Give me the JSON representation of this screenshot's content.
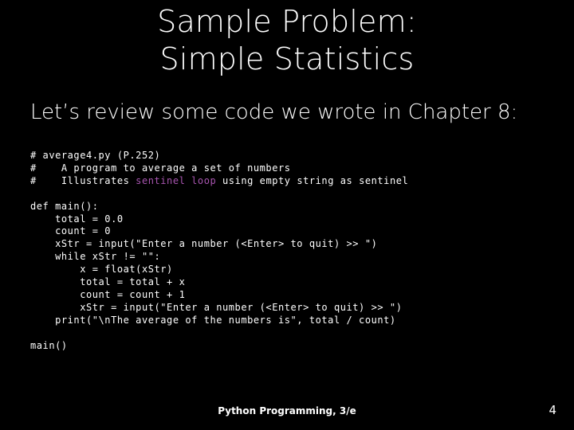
{
  "slide": {
    "background_color": "#000000",
    "text_color": "#ffffff",
    "accent_color": "#a855b0"
  },
  "title": {
    "line1": "Sample Problem:",
    "line2": "Simple Statistics"
  },
  "body": {
    "lead_in": "Let’s review some code we wrote in Chapter 8:"
  },
  "code": {
    "language": "python",
    "lines": [
      {
        "text": "# average4.py (P.252)"
      },
      {
        "text": "#    A program to average a set of numbers"
      },
      {
        "pre": "#    Illustrates ",
        "highlight": "sentinel loop",
        "post": " using empty string as sentinel"
      },
      {
        "text": ""
      },
      {
        "text": "def main():"
      },
      {
        "text": "    total = 0.0"
      },
      {
        "text": "    count = 0"
      },
      {
        "text": "    xStr = input(\"Enter a number (<Enter> to quit) >> \")"
      },
      {
        "text": "    while xStr != \"\":"
      },
      {
        "text": "        x = float(xStr)"
      },
      {
        "text": "        total = total + x"
      },
      {
        "text": "        count = count + 1"
      },
      {
        "text": "        xStr = input(\"Enter a number (<Enter> to quit) >> \")"
      },
      {
        "text": "    print(\"\\nThe average of the numbers is\", total / count)"
      },
      {
        "text": ""
      },
      {
        "text": "main()"
      }
    ]
  },
  "footer": {
    "title": "Python Programming, 3/e",
    "page_number": "4"
  }
}
